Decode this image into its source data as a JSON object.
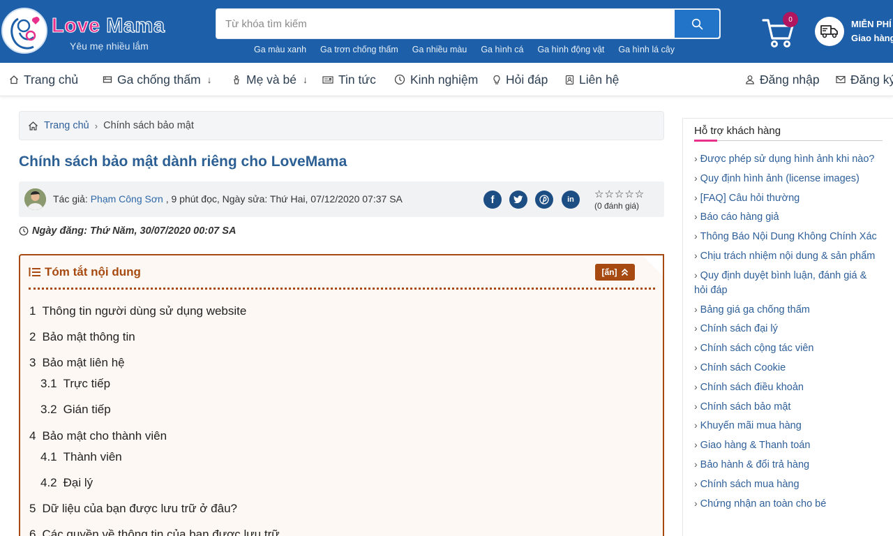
{
  "brand": {
    "word1": "Love",
    "word2": "Mama",
    "slogan": "Yêu mẹ nhiều lắm"
  },
  "search": {
    "placeholder": "Từ khóa tìm kiếm",
    "value": ""
  },
  "quick_tags": [
    "Ga màu xanh",
    "Ga trơn chống thấm",
    "Ga nhiều màu",
    "Ga hình cá",
    "Ga hình động vật",
    "Ga hình lá cây"
  ],
  "cart": {
    "count": "0"
  },
  "shipping": {
    "line1": "MIỄN PHÍ",
    "line2": "Giao hàng"
  },
  "nav": {
    "home": "Trang chủ",
    "waterproof": "Ga chống thấm",
    "mom_baby": "Mẹ và bé",
    "news": "Tin tức",
    "experience": "Kinh nghiệm",
    "qa": "Hỏi đáp",
    "contact": "Liên hệ",
    "login": "Đăng nhập",
    "register": "Đăng ký"
  },
  "breadcrumb": {
    "home": "Trang chủ",
    "current": "Chính sách bảo mật"
  },
  "article": {
    "title": "Chính sách bảo mật dành riêng cho LoveMama",
    "author_prefix": "Tác giả:",
    "author": "Phạm Công Sơn",
    "meta_suffix": ", 9 phút đọc, Ngày sửa: Thứ Hai, 07/12/2020 07:37 SA",
    "rating_stars": "☆☆☆☆☆",
    "rating_count": "(0 đánh giá)",
    "posted": "Ngày đăng: Thứ Năm, 30/07/2020 00:07 SA"
  },
  "toc": {
    "title": "Tóm tắt nội dung",
    "toggle_label": "[ẩn]",
    "items": [
      {
        "num": "1",
        "text": "Thông tin người dùng sử dụng website"
      },
      {
        "num": "2",
        "text": "Bảo mật thông tin"
      },
      {
        "num": "3",
        "text": "Bảo mật liên hệ"
      },
      {
        "num": "3.1",
        "text": "Trực tiếp"
      },
      {
        "num": "3.2",
        "text": "Gián tiếp"
      },
      {
        "num": "4",
        "text": "Bảo mật cho thành viên"
      },
      {
        "num": "4.1",
        "text": "Thành viên"
      },
      {
        "num": "4.2",
        "text": "Đại lý"
      },
      {
        "num": "5",
        "text": "Dữ liệu của bạn được lưu trữ ở đâu?"
      },
      {
        "num": "6",
        "text": "Các quyền về thông tin của bạn được lưu trữ"
      }
    ]
  },
  "sidebar": {
    "title": "Hỗ trợ khách hàng",
    "items": [
      "Được phép sử dụng hình ảnh khi nào?",
      "Quy định hình ảnh (license images)",
      "[FAQ] Câu hỏi thường",
      "Báo cáo hàng giả",
      "Thông Báo Nội Dung Không Chính Xác",
      "Chịu trách nhiệm nội dung & sản phẩm",
      "Quy định duyệt bình luận, đánh giá & hỏi đáp",
      "Bảng giá ga chống thấm",
      "Chính sách đại lý",
      "Chính sách cộng tác viên",
      "Chính sách Cookie",
      "Chính sách điều khoản",
      "Chính sách bảo mật",
      "Khuyến mãi mua hàng",
      "Giao hàng & Thanh toán",
      "Bảo hành & đổi trả hàng",
      "Chính sách mua hàng",
      "Chứng nhận an toàn cho bé"
    ]
  },
  "colors": {
    "header_bg": "#1d5fa8",
    "accent_pink": "#e8308c",
    "toc_accent": "#a64a12",
    "link_blue": "#2e5f99"
  }
}
